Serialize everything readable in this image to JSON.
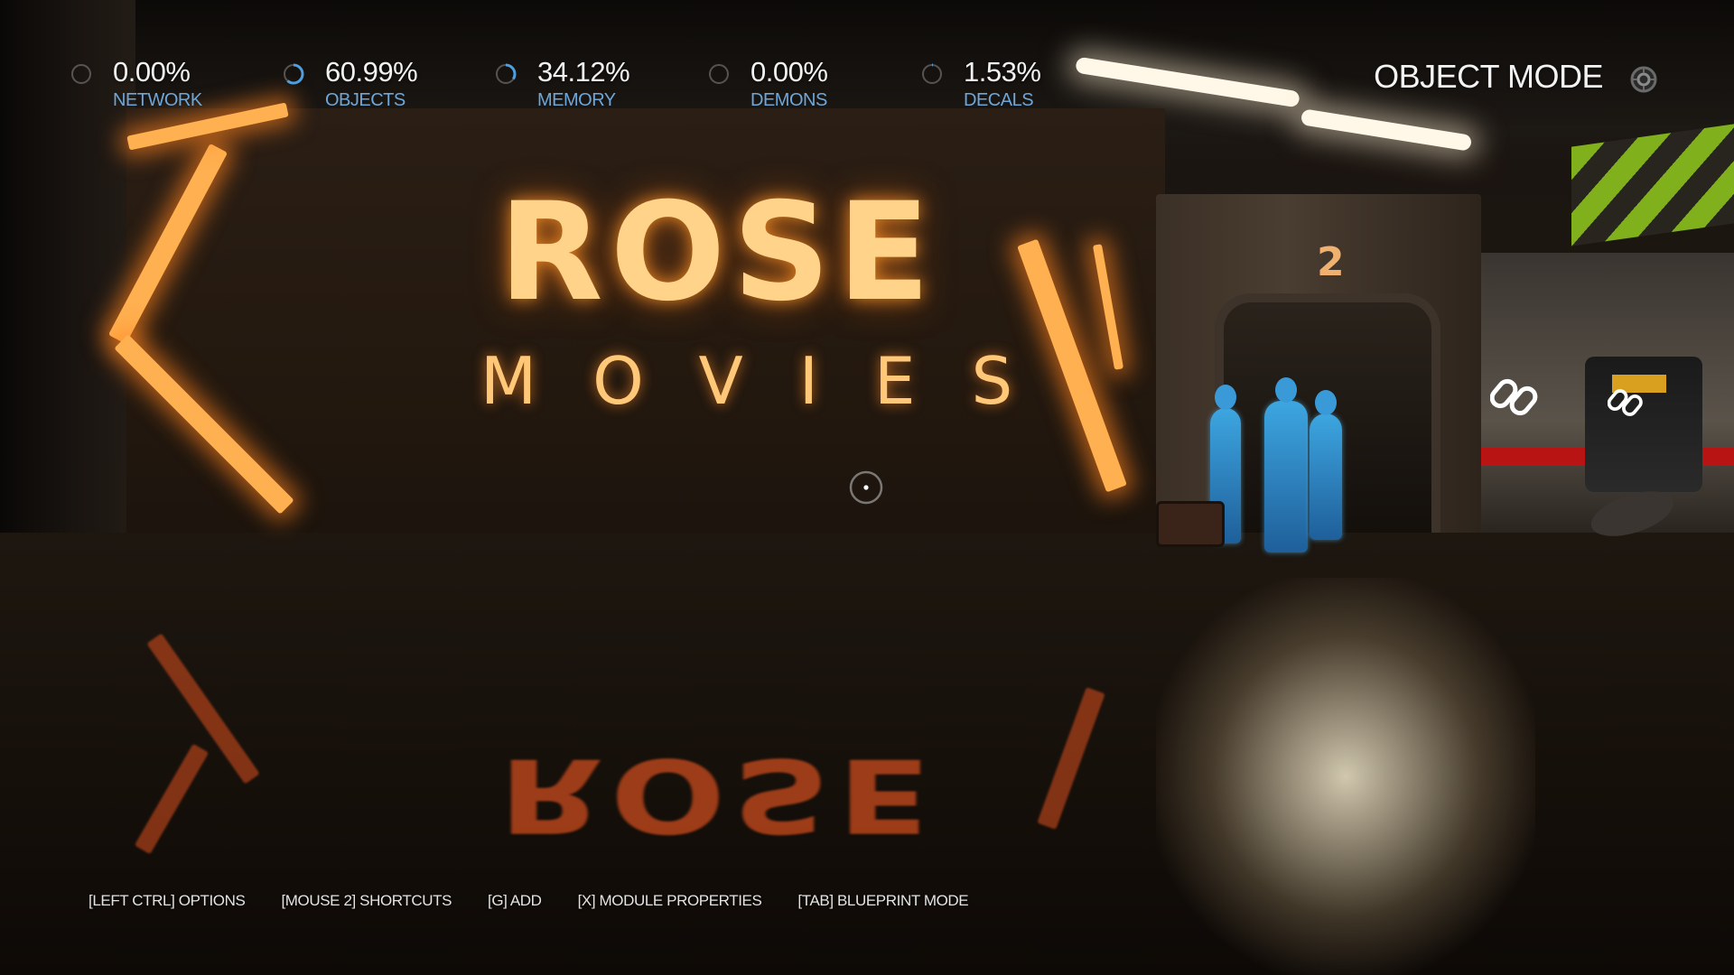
{
  "hud": {
    "stats": [
      {
        "value": "0.00%",
        "label": "NETWORK",
        "progress": 0.0
      },
      {
        "value": "60.99%",
        "label": "OBJECTS",
        "progress": 0.6099
      },
      {
        "value": "34.12%",
        "label": "MEMORY",
        "progress": 0.3412
      },
      {
        "value": "0.00%",
        "label": "DEMONS",
        "progress": 0.0
      },
      {
        "value": "1.53%",
        "label": "DECALS",
        "progress": 0.0153
      }
    ],
    "mode": {
      "title": "OBJECT MODE",
      "icon": "mode-settings-icon"
    }
  },
  "scene": {
    "sign_main": "ROSE",
    "sign_sub": "MOVIES",
    "door_number": "2"
  },
  "shortcuts": [
    {
      "label": "[LEFT CTRL] OPTIONS"
    },
    {
      "label": "[MOUSE 2] SHORTCUTS"
    },
    {
      "label": "[G] ADD"
    },
    {
      "label": "[X] MODULE PROPERTIES"
    },
    {
      "label": "[TAB] BLUEPRINT MODE"
    }
  ],
  "colors": {
    "stat_label": "#6ea6d8",
    "ring_progress": "#4f9ee0",
    "neon_orange": "#ffb050",
    "hologram_blue": "#3da6e0"
  }
}
